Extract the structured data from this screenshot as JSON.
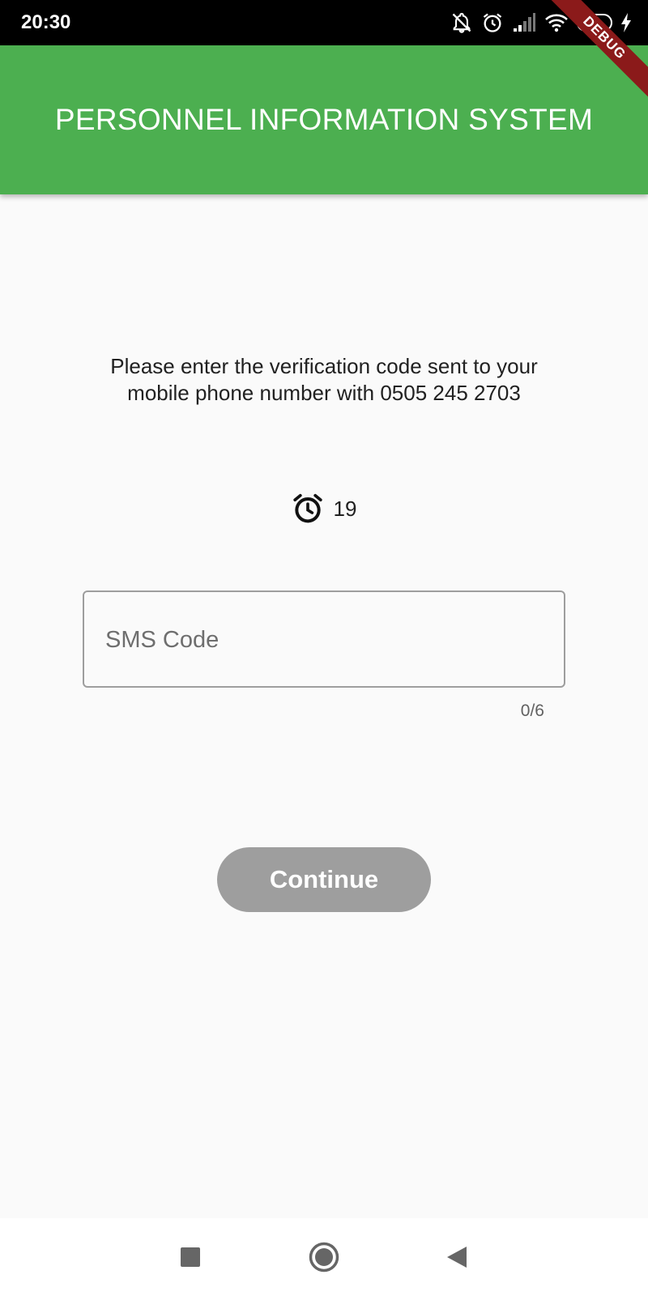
{
  "status_bar": {
    "time": "20:30",
    "battery_level": "44",
    "battery_fraction": 0.44,
    "icons": [
      "notifications-off-icon",
      "alarm-icon",
      "cellular-signal-icon",
      "wifi-icon",
      "battery-icon",
      "charging-bolt-icon"
    ]
  },
  "debug_banner": "DEBUG",
  "app_bar": {
    "title": "PERSONNEL INFORMATION SYSTEM",
    "color": "#4caf50"
  },
  "content": {
    "instructions": "Please enter the verification code sent to your mobile phone number with 0505 245 2703",
    "timer": {
      "icon": "alarm-clock-icon",
      "value": "19"
    },
    "sms_field": {
      "placeholder": "SMS Code",
      "value": "",
      "counter": "0/6"
    },
    "continue_label": "Continue"
  },
  "nav_bar": {
    "icons": [
      "recents-square-icon",
      "home-circle-icon",
      "back-triangle-icon"
    ]
  }
}
